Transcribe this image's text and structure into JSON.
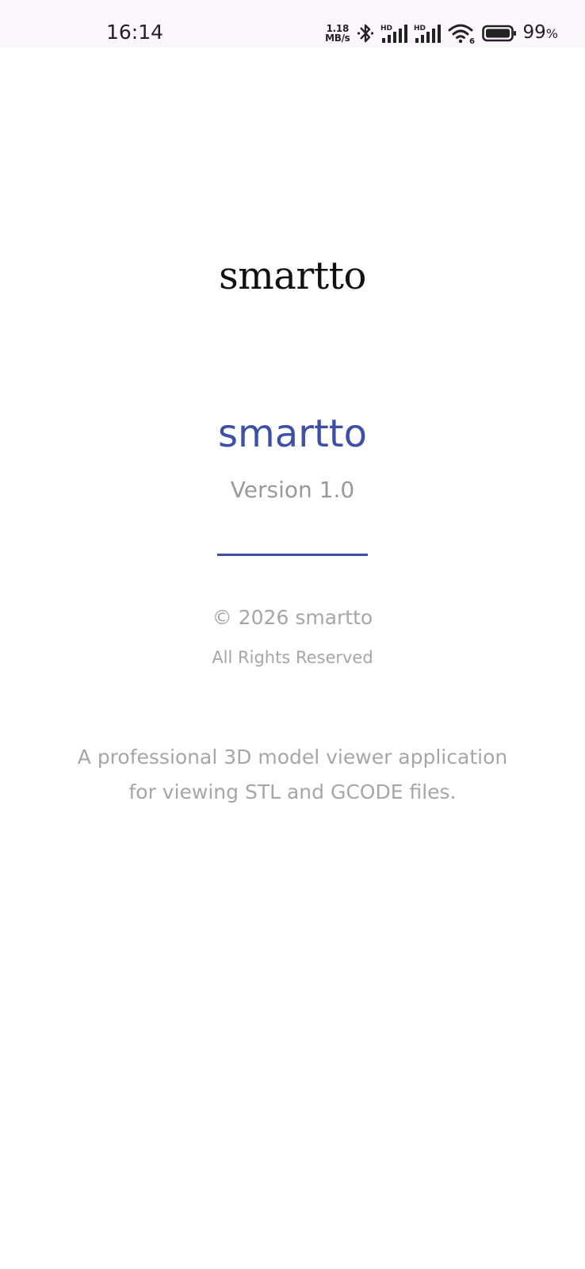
{
  "status_bar": {
    "time": "16:14",
    "net_speed_value": "1.18",
    "net_speed_unit": "MB/s",
    "signal1_label": "HD",
    "signal2_label": "HD",
    "wifi_label": "6",
    "battery_percent": "99",
    "battery_percent_sign": "%",
    "icons": [
      "bluetooth-icon",
      "cellular-signal-icon",
      "cellular-signal-icon",
      "wifi-icon",
      "battery-icon"
    ]
  },
  "logo": {
    "text": "smartto"
  },
  "about": {
    "app_name": "smartto",
    "version": "Version 1.0",
    "copyright": "© 2026 smartto",
    "rights": "All Rights Reserved",
    "description_line1": "A professional 3D model viewer application",
    "description_line2": "for viewing STL and GCODE files."
  },
  "colors": {
    "accent": "#3e4fa8",
    "muted_text": "#a6a6a6",
    "status_bar_bg": "#fcf6fd"
  }
}
